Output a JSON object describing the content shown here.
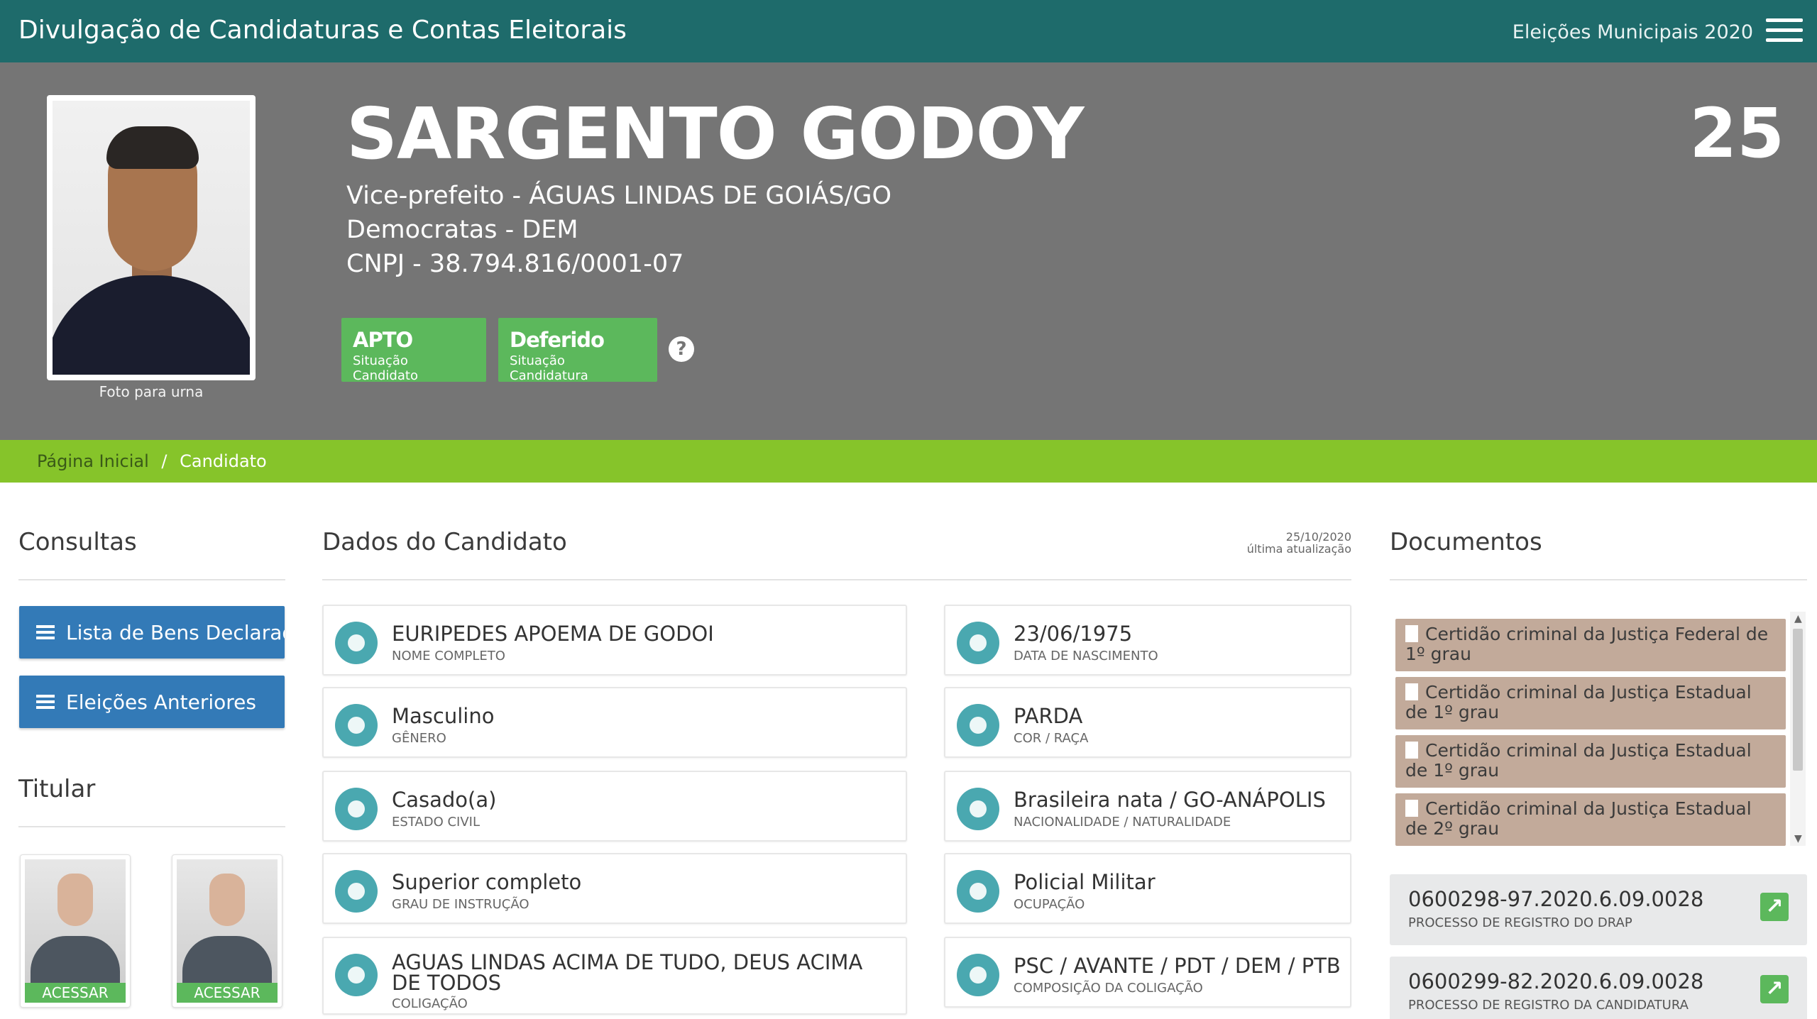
{
  "topbar": {
    "title": "Divulgação de Candidaturas e Contas Eleitorais",
    "election": "Eleições Municipais 2020",
    "menu_icon": "hamburger-menu-icon"
  },
  "candidate": {
    "name": "SARGENTO GODOY",
    "number": "25",
    "role_line": "Vice-prefeito - ÁGUAS LINDAS DE GOIÁS/GO",
    "party_line": "Democratas - DEM",
    "cnpj_line": "CNPJ - 38.794.816/0001-07",
    "photo_caption": "Foto para urna",
    "badges": [
      {
        "main": "APTO",
        "sub": "Situação Candidato",
        "color": "#5cb85c"
      },
      {
        "main": "Deferido",
        "sub": "Situação Candidatura",
        "color": "#5cb85c"
      }
    ],
    "help_symbol": "?"
  },
  "breadcrumb": {
    "home": "Página Inicial",
    "separator": "/",
    "current": "Candidato"
  },
  "consultas": {
    "title": "Consultas",
    "buttons": [
      "Lista de Bens Declarados",
      "Eleições Anteriores"
    ]
  },
  "titular": {
    "title": "Titular",
    "cards": [
      {
        "action": "ACESSAR"
      },
      {
        "action": "ACESSAR"
      }
    ]
  },
  "dados": {
    "title": "Dados do Candidato",
    "update_date": "25/10/2020",
    "update_label": "última atualização",
    "fields": [
      {
        "value": "EURIPEDES APOEMA DE GODOI",
        "label": "NOME COMPLETO",
        "icon": "user-icon"
      },
      {
        "value": "23/06/1975",
        "label": "DATA DE NASCIMENTO",
        "icon": "calendar-icon"
      },
      {
        "value": "Masculino",
        "label": "GÊNERO",
        "icon": "gender-icon"
      },
      {
        "value": "PARDA",
        "label": "COR / RAÇA",
        "icon": "person-icon"
      },
      {
        "value": "Casado(a)",
        "label": "ESTADO CIVIL",
        "icon": "ring-icon"
      },
      {
        "value": "Brasileira nata / GO-ANÁPOLIS",
        "label": "NACIONALIDADE / NATURALIDADE",
        "icon": "map-icon"
      },
      {
        "value": "Superior completo",
        "label": "GRAU DE INSTRUÇÃO",
        "icon": "graduation-cap-icon"
      },
      {
        "value": "Policial Militar",
        "label": "OCUPAÇÃO",
        "icon": "institution-icon"
      },
      {
        "value": "AGUAS LINDAS ACIMA DE TUDO, DEUS ACIMA DE TODOS",
        "label": "COLIGAÇÃO",
        "icon": "group-icon"
      },
      {
        "value": "PSC / AVANTE / PDT / DEM / PTB",
        "label": "COMPOSIÇÃO DA COLIGAÇÃO",
        "icon": "folder-icon"
      }
    ]
  },
  "documentos": {
    "title": "Documentos",
    "items": [
      "Certidão criminal da Justiça Federal de 1º grau",
      "Certidão criminal da Justiça Estadual de 1º grau",
      "Certidão criminal da Justiça Estadual de 1º grau",
      "Certidão criminal da Justiça Estadual de 2º grau"
    ],
    "processes": [
      {
        "number": "0600298-97.2020.6.09.0028",
        "label": "PROCESSO DE REGISTRO DO DRAP"
      },
      {
        "number": "0600299-82.2020.6.09.0028",
        "label": "PROCESSO DE REGISTRO DA CANDIDATURA"
      }
    ]
  }
}
